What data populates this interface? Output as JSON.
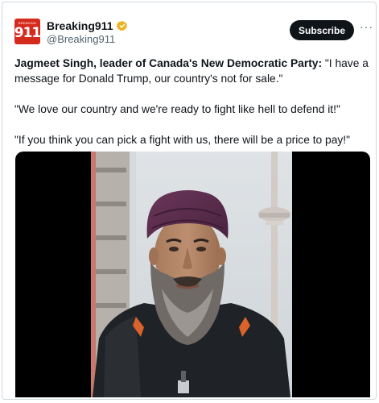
{
  "account": {
    "avatar_text": "911",
    "avatar_small_text": "BREAKING",
    "name": "Breaking911",
    "handle": "@Breaking911",
    "verified_color": "#e8b424"
  },
  "actions": {
    "subscribe_label": "Subscribe",
    "more_label": "···"
  },
  "tweet": {
    "lead": "Jagmeet Singh, leader of Canada's New Democratic Party:",
    "line1_rest": " \"I have a message for Donald Trump, our country's not for sale.\"",
    "line2": "\"We love our country and we're ready to fight like hell to defend it!\"",
    "line3": "\"If you think you can pick a fight with us, there will be a price to pay!\""
  },
  "media": {
    "type": "video",
    "subject": "man with purple turban and grey beard, CN Tower in background"
  },
  "colors": {
    "brand_red": "#d52b1e",
    "turban": "#5a2c4c",
    "jacket": "#1f2226"
  }
}
